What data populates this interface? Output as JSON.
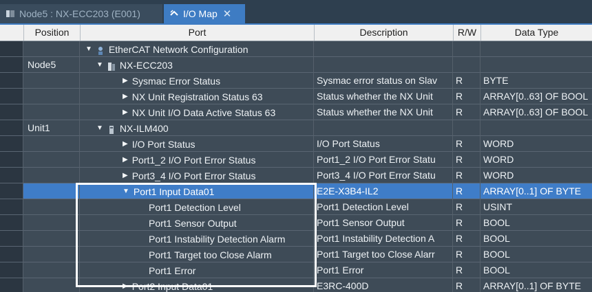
{
  "tabs": [
    {
      "label": "Node5 : NX-ECC203 (E001)",
      "active": false
    },
    {
      "label": "I/O Map",
      "active": true
    }
  ],
  "columns": {
    "position": "Position",
    "port": "Port",
    "description": "Description",
    "rw": "R/W",
    "datatype": "Data Type"
  },
  "rows": [
    {
      "position": "",
      "port": "EtherCAT Network Configuration",
      "description": "",
      "rw": "",
      "datatype": "",
      "level": 0,
      "expander": "down",
      "icon": "network-icon"
    },
    {
      "position": "Node5",
      "port": "NX-ECC203",
      "description": "",
      "rw": "",
      "datatype": "",
      "level": 1,
      "expander": "down",
      "icon": "coupler-icon"
    },
    {
      "position": "",
      "port": "Sysmac Error Status",
      "description": "Sysmac error status on Slav",
      "rw": "R",
      "datatype": "BYTE",
      "level": 2,
      "expander": "right"
    },
    {
      "position": "",
      "port": "NX Unit Registration Status 63",
      "description": "Status whether the NX Unit",
      "rw": "R",
      "datatype": "ARRAY[0..63] OF BOOL",
      "level": 2,
      "expander": "right"
    },
    {
      "position": "",
      "port": "NX Unit I/O Data Active Status 63",
      "description": "Status whether the NX Unit",
      "rw": "R",
      "datatype": "ARRAY[0..63] OF BOOL",
      "level": 2,
      "expander": "right"
    },
    {
      "position": "Unit1",
      "port": "NX-ILM400",
      "description": "",
      "rw": "",
      "datatype": "",
      "level": 1,
      "expander": "down",
      "icon": "unit-icon"
    },
    {
      "position": "",
      "port": "I/O Port Status",
      "description": "I/O Port Status",
      "rw": "R",
      "datatype": "WORD",
      "level": 2,
      "expander": "right"
    },
    {
      "position": "",
      "port": "Port1_2 I/O Port Error Status",
      "description": "Port1_2 I/O Port Error Statu",
      "rw": "R",
      "datatype": "WORD",
      "level": 2,
      "expander": "right"
    },
    {
      "position": "",
      "port": "Port3_4 I/O Port Error Status",
      "description": "Port3_4 I/O Port Error Statu",
      "rw": "R",
      "datatype": "WORD",
      "level": 2,
      "expander": "right"
    },
    {
      "position": "",
      "port": "Port1 Input Data01",
      "description": "E2E-X3B4-IL2",
      "rw": "R",
      "datatype": "ARRAY[0..1] OF BYTE",
      "level": 2,
      "expander": "down",
      "selected": true
    },
    {
      "position": "",
      "port": "Port1 Detection Level",
      "description": "Port1 Detection Level",
      "rw": "R",
      "datatype": "USINT",
      "level": 3
    },
    {
      "position": "",
      "port": "Port1 Sensor Output",
      "description": "Port1 Sensor Output",
      "rw": "R",
      "datatype": "BOOL",
      "level": 3
    },
    {
      "position": "",
      "port": "Port1 Instability Detection Alarm",
      "description": "Port1 Instability Detection A",
      "rw": "R",
      "datatype": "BOOL",
      "level": 3
    },
    {
      "position": "",
      "port": "Port1 Target too Close Alarm",
      "description": "Port1 Target too Close Alarr",
      "rw": "R",
      "datatype": "BOOL",
      "level": 3
    },
    {
      "position": "",
      "port": "Port1 Error",
      "description": "Port1 Error",
      "rw": "R",
      "datatype": "BOOL",
      "level": 3
    },
    {
      "position": "",
      "port": "Port2 Input Data01",
      "description": "E3RC-400D",
      "rw": "R",
      "datatype": "ARRAY[0..1] OF BYTE",
      "level": 2,
      "expander": "right"
    }
  ]
}
